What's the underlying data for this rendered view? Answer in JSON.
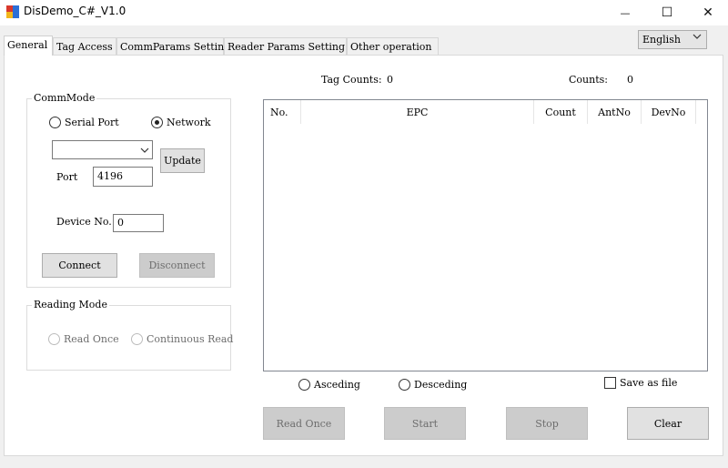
{
  "window": {
    "title": "DisDemo_C#_V1.0",
    "minimize_glyph": "—",
    "maximize_glyph": "☐",
    "close_glyph": "✕"
  },
  "tabs": [
    {
      "label": "General",
      "active": true
    },
    {
      "label": "Tag Access",
      "active": false
    },
    {
      "label": "CommParams Setting",
      "active": false
    },
    {
      "label": "Reader Params Setting",
      "active": false
    },
    {
      "label": "Other operation",
      "active": false
    }
  ],
  "language": {
    "selected": "English"
  },
  "comm_mode": {
    "title": "CommMode",
    "serial_port_label": "Serial Port",
    "network_label": "Network",
    "selected": "Network",
    "port_combo_value": "",
    "update_label": "Update",
    "port_label": "Port",
    "port_value": "4196",
    "device_no_label": "Device No.",
    "device_no_value": "0",
    "connect_label": "Connect",
    "disconnect_label": "Disconnect"
  },
  "reading_mode": {
    "title": "Reading Mode",
    "read_once_label": "Read Once",
    "continuous_label": "Continuous Read"
  },
  "stats": {
    "tag_counts_label": "Tag Counts:",
    "tag_counts_value": "0",
    "counts_label": "Counts:",
    "counts_value": "0"
  },
  "table": {
    "columns": [
      "No.",
      "EPC",
      "Count",
      "AntNo",
      "DevNo"
    ],
    "rows": []
  },
  "sort": {
    "ascending_label": "Asceding",
    "descending_label": "Desceding"
  },
  "save_as_file_label": "Save as file",
  "actions": {
    "read_once_label": "Read Once",
    "start_label": "Start",
    "stop_label": "Stop",
    "clear_label": "Clear"
  },
  "colors": {
    "app_icon_red": "#d9382c",
    "app_icon_blue": "#2b6fd6",
    "app_icon_yellow": "#f2b61b"
  }
}
